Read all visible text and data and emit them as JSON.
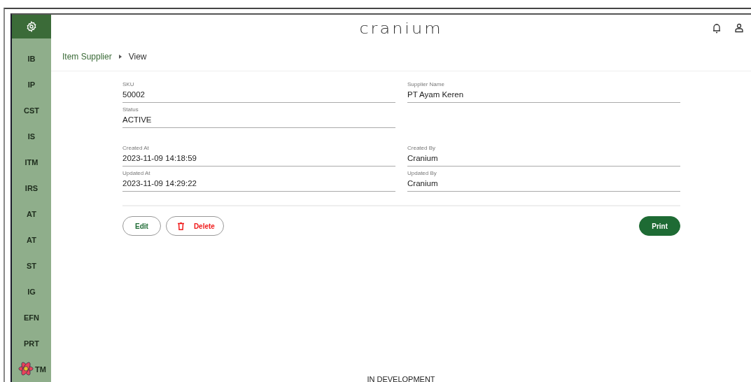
{
  "app": {
    "logo": "cranium"
  },
  "sidebar": {
    "items": [
      {
        "label": "IB"
      },
      {
        "label": "IP"
      },
      {
        "label": "CST"
      },
      {
        "label": "IS"
      },
      {
        "label": "ITM"
      },
      {
        "label": "IRS"
      },
      {
        "label": "AT"
      },
      {
        "label": "AT"
      },
      {
        "label": "ST"
      },
      {
        "label": "IG"
      },
      {
        "label": "EFN"
      },
      {
        "label": "PRT"
      },
      {
        "label": "TM"
      }
    ]
  },
  "breadcrumb": {
    "items": [
      "Item Supplier",
      "View"
    ]
  },
  "sections": [
    {
      "columns": [
        [
          {
            "label": "SKU",
            "value": "50002"
          },
          {
            "label": "Status",
            "value": "ACTIVE"
          }
        ],
        [
          {
            "label": "Supplier Name",
            "value": "PT Ayam Keren"
          }
        ]
      ]
    },
    {
      "columns": [
        [
          {
            "label": "Created At",
            "value": "2023-11-09 14:18:59"
          },
          {
            "label": "Updated At",
            "value": "2023-11-09 14:29:22"
          }
        ],
        [
          {
            "label": "Created By",
            "value": "Cranium"
          },
          {
            "label": "Updated By",
            "value": "Cranium"
          }
        ]
      ]
    }
  ],
  "buttons": [
    {
      "label": "Edit",
      "kind": "outline"
    },
    {
      "label": "Delete",
      "kind": "danger"
    },
    {
      "label": "Print",
      "kind": "primary"
    }
  ],
  "footer": "IN DEVELOPMENT"
}
